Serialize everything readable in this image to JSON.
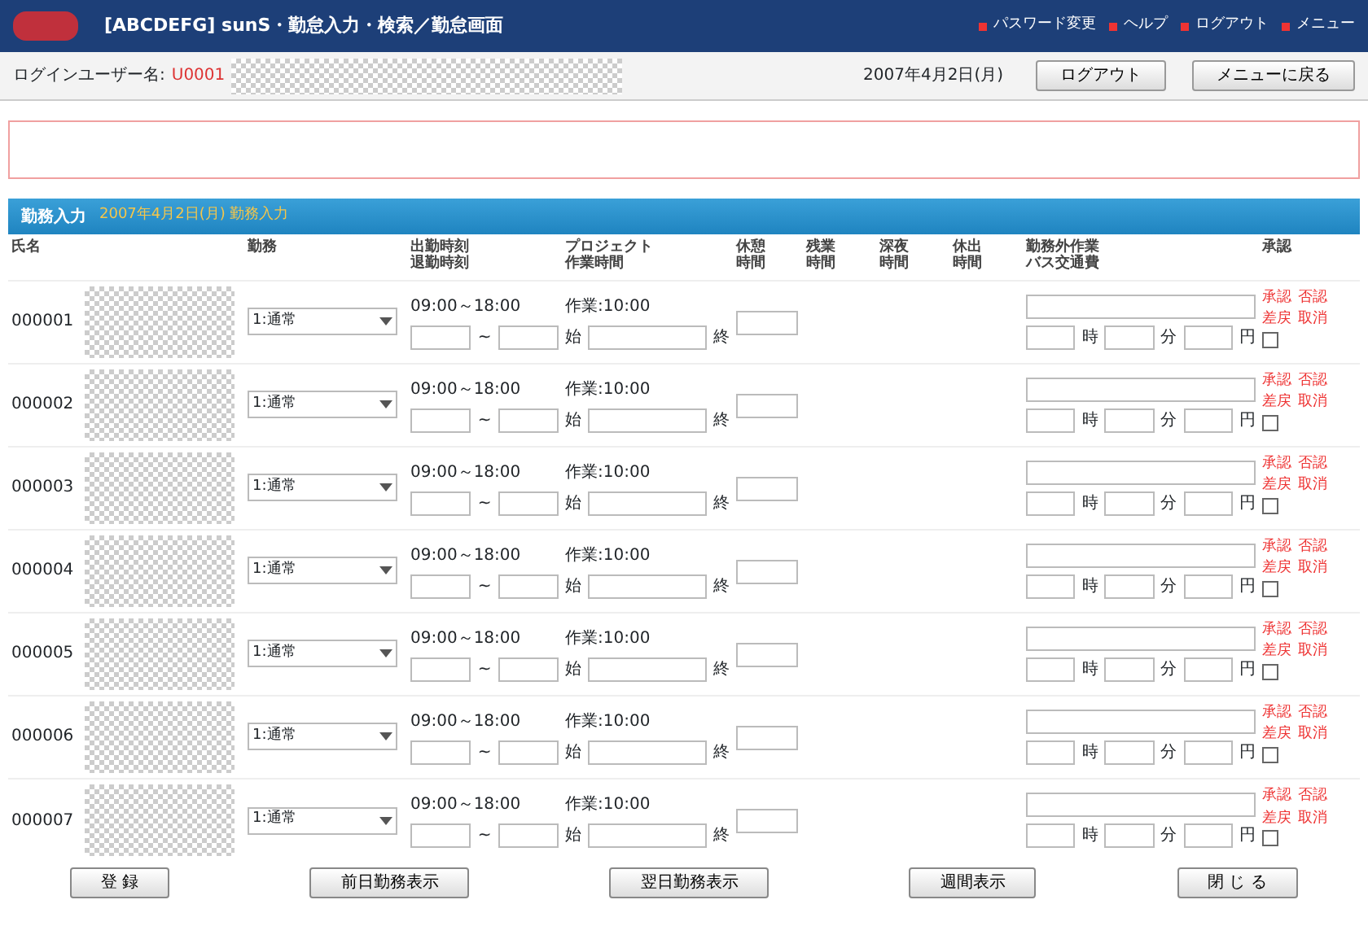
{
  "header": {
    "title": "[ABCDEFG] sunS・勤怠入力・検索／勤怠画面",
    "links": [
      "パスワード変更",
      "ヘルプ",
      "ログアウト",
      "メニュー"
    ]
  },
  "user_bar": {
    "label": "ログインユーザー名:",
    "user_id": "U0001",
    "date": "2007年4月2日(月)",
    "buttons": [
      "ログアウト",
      "メニューに戻る"
    ]
  },
  "section": {
    "title": "勤務入力",
    "subtitle": "2007年4月2日(月) 勤務入力"
  },
  "columns": [
    {
      "lines": [
        "氏名"
      ]
    },
    {
      "lines": [
        "勤務"
      ]
    },
    {
      "lines": [
        "出勤時刻",
        "退勤時刻"
      ]
    },
    {
      "lines": [
        "プロジェクト",
        "作業時間"
      ]
    },
    {
      "lines": [
        "休憩",
        "時間"
      ]
    },
    {
      "lines": [
        "残業",
        "時間"
      ]
    },
    {
      "lines": [
        "深夜",
        "時間"
      ]
    },
    {
      "lines": [
        "休出",
        "時間"
      ]
    },
    {
      "lines": [
        "勤務外作業",
        "バス交通費"
      ]
    },
    {
      "lines": [
        "承認"
      ]
    }
  ],
  "rows": [
    {
      "id": "000001",
      "shift": "1:通常",
      "schedule": "09:00～18:00",
      "range_separator": "~",
      "project": "作業:10:00",
      "start_label": "始",
      "end_label": "終",
      "units": [
        "時",
        "分",
        "円"
      ],
      "approvals": [
        "承認",
        "否認",
        "差戻",
        "取消"
      ],
      "checked": false
    },
    {
      "id": "000002",
      "shift": "1:通常",
      "schedule": "09:00～18:00",
      "range_separator": "~",
      "project": "作業:10:00",
      "start_label": "始",
      "end_label": "終",
      "units": [
        "時",
        "分",
        "円"
      ],
      "approvals": [
        "承認",
        "否認",
        "差戻",
        "取消"
      ],
      "checked": false
    },
    {
      "id": "000003",
      "shift": "1:通常",
      "schedule": "09:00～18:00",
      "range_separator": "~",
      "project": "作業:10:00",
      "start_label": "始",
      "end_label": "終",
      "units": [
        "時",
        "分",
        "円"
      ],
      "approvals": [
        "承認",
        "否認",
        "差戻",
        "取消"
      ],
      "checked": false
    },
    {
      "id": "000004",
      "shift": "1:通常",
      "schedule": "09:00～18:00",
      "range_separator": "~",
      "project": "作業:10:00",
      "start_label": "始",
      "end_label": "終",
      "units": [
        "時",
        "分",
        "円"
      ],
      "approvals": [
        "承認",
        "否認",
        "差戻",
        "取消"
      ],
      "checked": false
    },
    {
      "id": "000005",
      "shift": "1:通常",
      "schedule": "09:00～18:00",
      "range_separator": "~",
      "project": "作業:10:00",
      "start_label": "始",
      "end_label": "終",
      "units": [
        "時",
        "分",
        "円"
      ],
      "approvals": [
        "承認",
        "否認",
        "差戻",
        "取消"
      ],
      "checked": false
    },
    {
      "id": "000006",
      "shift": "1:通常",
      "schedule": "09:00～18:00",
      "range_separator": "~",
      "project": "作業:10:00",
      "start_label": "始",
      "end_label": "終",
      "units": [
        "時",
        "分",
        "円"
      ],
      "approvals": [
        "承認",
        "否認",
        "差戻",
        "取消"
      ],
      "checked": false
    },
    {
      "id": "000007",
      "shift": "1:通常",
      "schedule": "09:00～18:00",
      "range_separator": "~",
      "project": "作業:10:00",
      "start_label": "始",
      "end_label": "終",
      "units": [
        "時",
        "分",
        "円"
      ],
      "approvals": [
        "承認",
        "否認",
        "差戻",
        "取消"
      ],
      "checked": false
    }
  ],
  "footer_buttons": [
    "登 録",
    "前日勤務表示",
    "翌日勤務表示",
    "週間表示",
    "閉 じ る"
  ]
}
